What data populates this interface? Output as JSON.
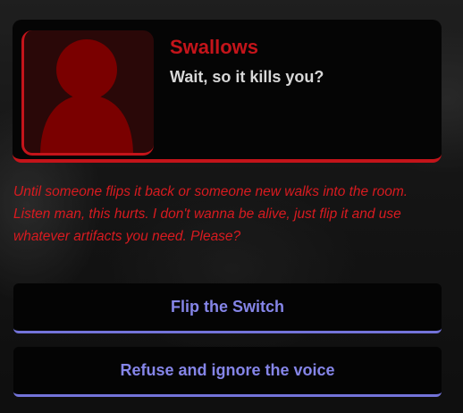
{
  "dialog": {
    "speaker_name": "Swallows",
    "speaker_line": "Wait, so it kills you?",
    "portrait_icon": "person-silhouette-icon",
    "narration": "Until someone flips it back or someone new walks into the room. Listen man, this hurts. I don't wanna be alive, just flip it and use whatever artifacts you need. Please?"
  },
  "choices": [
    {
      "label": "Flip the Switch"
    },
    {
      "label": "Refuse and ignore the voice"
    }
  ],
  "colors": {
    "accent_red": "#c4141a",
    "narration_red": "#d81b20",
    "choice_text": "#8585e8",
    "choice_underline": "#7373d9",
    "portrait_silhouette": "#7a0000"
  }
}
